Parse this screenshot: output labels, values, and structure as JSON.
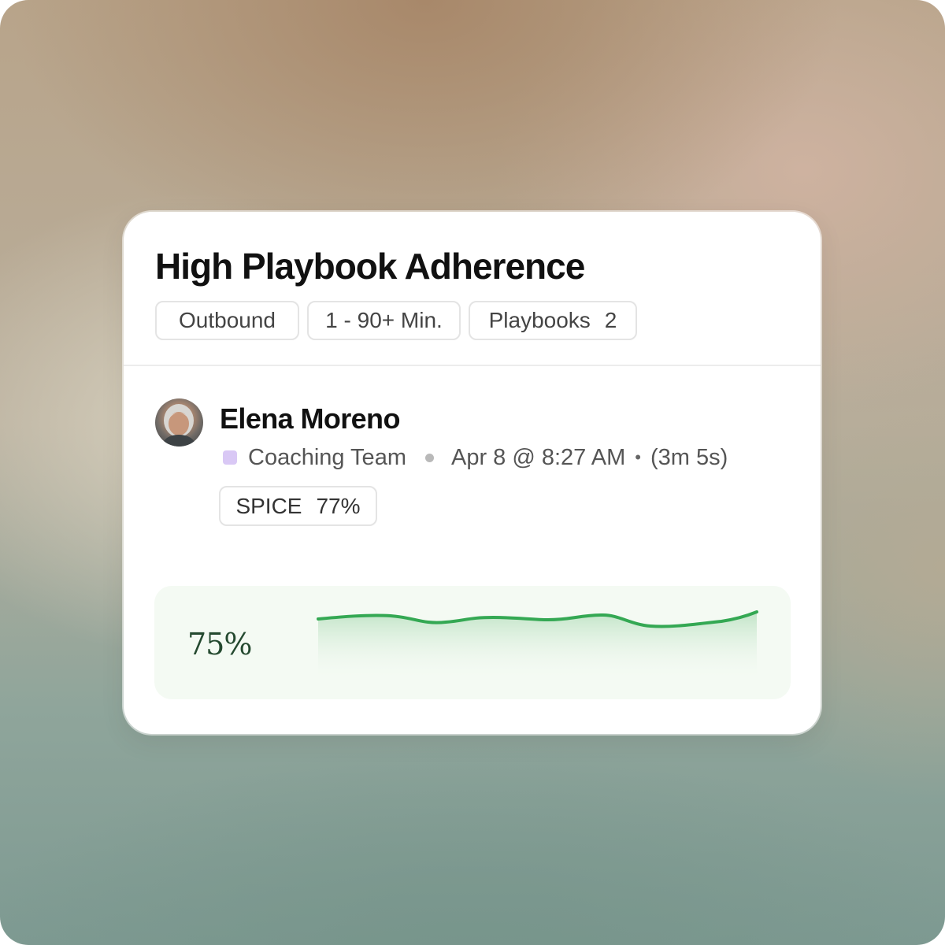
{
  "card": {
    "title": "High Playbook Adherence",
    "filters": [
      {
        "label": "Outbound"
      },
      {
        "label": "1 - 90+ Min."
      },
      {
        "label": "Playbooks",
        "count": "2"
      }
    ]
  },
  "call": {
    "person_name": "Elena Moreno",
    "team": "Coaching Team",
    "team_color": "#d9c8f5",
    "datetime": "Apr 8 @ 8:27 AM",
    "duration": "(3m 5s)",
    "score": {
      "label": "SPICE",
      "value": "77%"
    }
  },
  "trend": {
    "value_label": "75%",
    "line_color": "#34a853"
  }
}
